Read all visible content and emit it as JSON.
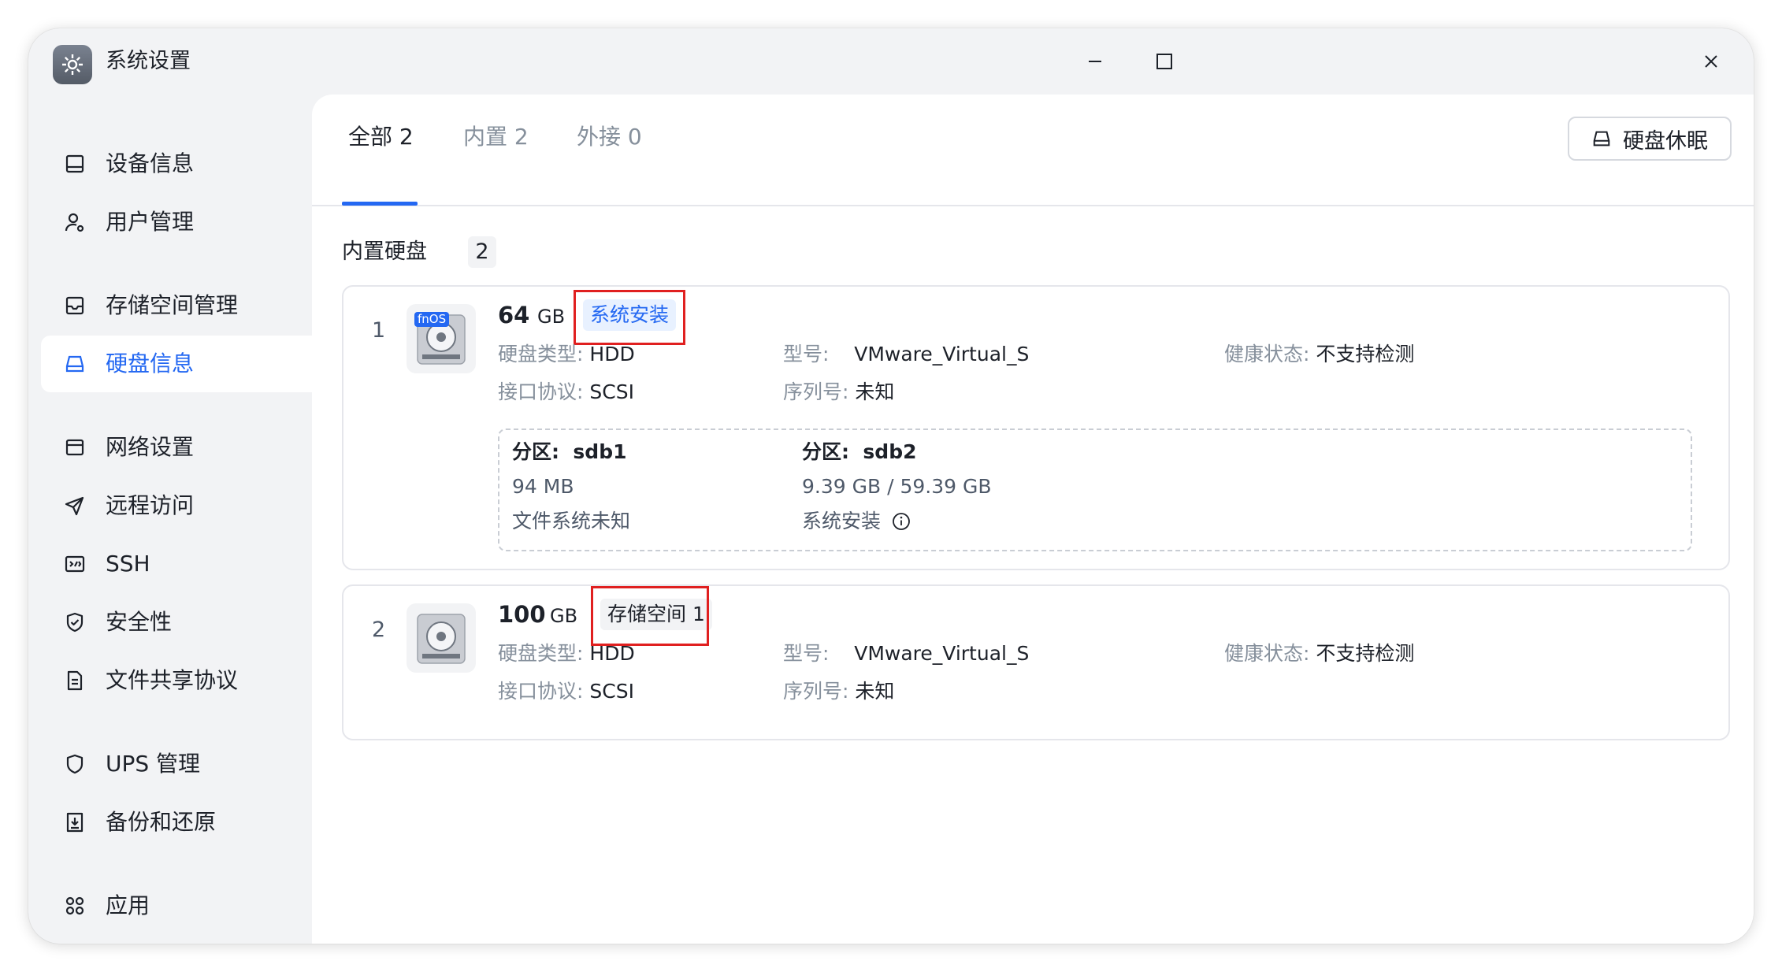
{
  "window": {
    "title": "系统设置"
  },
  "sidebar": {
    "items": [
      {
        "label": "设备信息",
        "icon": "device-info-icon"
      },
      {
        "label": "用户管理",
        "icon": "user-manage-icon"
      },
      {
        "label": "存储空间管理",
        "icon": "storage-manage-icon"
      },
      {
        "label": "硬盘信息",
        "icon": "disk-info-icon",
        "active": true
      },
      {
        "label": "网络设置",
        "icon": "network-icon"
      },
      {
        "label": "远程访问",
        "icon": "send-icon"
      },
      {
        "label": "SSH",
        "icon": "terminal-icon"
      },
      {
        "label": "安全性",
        "icon": "shield-check-icon"
      },
      {
        "label": "文件共享协议",
        "icon": "file-doc-icon"
      },
      {
        "label": "UPS 管理",
        "icon": "shield-icon"
      },
      {
        "label": "备份和还原",
        "icon": "backup-icon"
      },
      {
        "label": "应用",
        "icon": "apps-icon"
      }
    ]
  },
  "tabs": [
    {
      "label": "全部 2",
      "active": true
    },
    {
      "label": "内置 2",
      "active": false
    },
    {
      "label": "外接 0",
      "active": false
    }
  ],
  "sleep_button": {
    "label": "硬盘休眠"
  },
  "section": {
    "title": "内置硬盘",
    "count": "2"
  },
  "disks": [
    {
      "index": "1",
      "size_value": "64",
      "size_unit": "GB",
      "badge": "fnOS",
      "tag": "系统安装",
      "disk_type_label": "硬盘类型:",
      "disk_type": "HDD",
      "interface_label": "接口协议:",
      "interface": "SCSI",
      "model_label": "型号:",
      "model": "VMware_Virtual_S",
      "serial_label": "序列号:",
      "serial": "未知",
      "health_label": "健康状态:",
      "health": "不支持检测",
      "partitions": [
        {
          "label": "分区:",
          "name": "sdb1",
          "size": "94 MB",
          "desc": "文件系统未知"
        },
        {
          "label": "分区:",
          "name": "sdb2",
          "size": "9.39 GB / 59.39 GB",
          "desc": "系统安装"
        }
      ]
    },
    {
      "index": "2",
      "size_value": "100",
      "size_unit": "GB",
      "tag": "存储空间 1",
      "disk_type_label": "硬盘类型:",
      "disk_type": "HDD",
      "interface_label": "接口协议:",
      "interface": "SCSI",
      "model_label": "型号:",
      "model": "VMware_Virtual_S",
      "serial_label": "序列号:",
      "serial": "未知",
      "health_label": "健康状态:",
      "health": "不支持检测"
    }
  ],
  "colors": {
    "accent": "#2468f2",
    "highlight": "#e02020",
    "sidebar_bg": "#f2f3f5"
  }
}
